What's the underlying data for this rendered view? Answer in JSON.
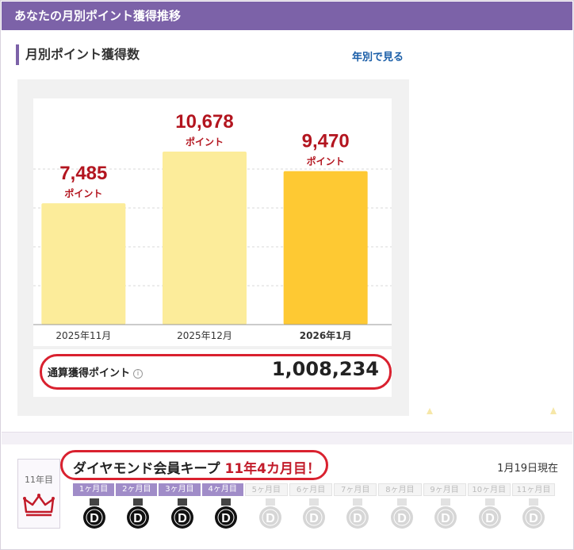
{
  "header": {
    "title": "あなたの月別ポイント獲得推移"
  },
  "section": {
    "title": "月別ポイント獲得数",
    "year_link": "年別で見る"
  },
  "chart_data": {
    "type": "bar",
    "categories": [
      "2025年11月",
      "2025年12月",
      "2026年1月"
    ],
    "values": [
      7485,
      10678,
      9470
    ],
    "value_labels": [
      "7,485",
      "10,678",
      "9,470"
    ],
    "unit_label": "ポイント",
    "highlight_category": "2026年1月",
    "ylim": [
      0,
      12000
    ],
    "colors": {
      "normal": "#fcec9a",
      "current": "#fec933",
      "value_text": "#b3151f",
      "grid": "#d9d9d9"
    }
  },
  "total": {
    "label": "通算獲得ポイント",
    "info_icon": "info-icon",
    "value": "1,008,234"
  },
  "status": {
    "rank_label": "11年目",
    "rank_icon": "crown-icon",
    "keep_title": "ダイヤモンド会員キープ",
    "keep_highlight": "11年4カ月目！",
    "date_note": "1月19日現在",
    "steps": [
      "1ヶ月目",
      "2ヶ月目",
      "3ヶ月目",
      "4ヶ月目",
      "5ヶ月目",
      "6ヶ月目",
      "7ヶ月目",
      "8ヶ月目",
      "9ヶ月目",
      "10ヶ月目",
      "11ヶ月目"
    ],
    "achieved_count": 4,
    "medal_letter": "D",
    "colors": {
      "accent": "#7c62a8",
      "highlight": "#d9212f"
    }
  }
}
